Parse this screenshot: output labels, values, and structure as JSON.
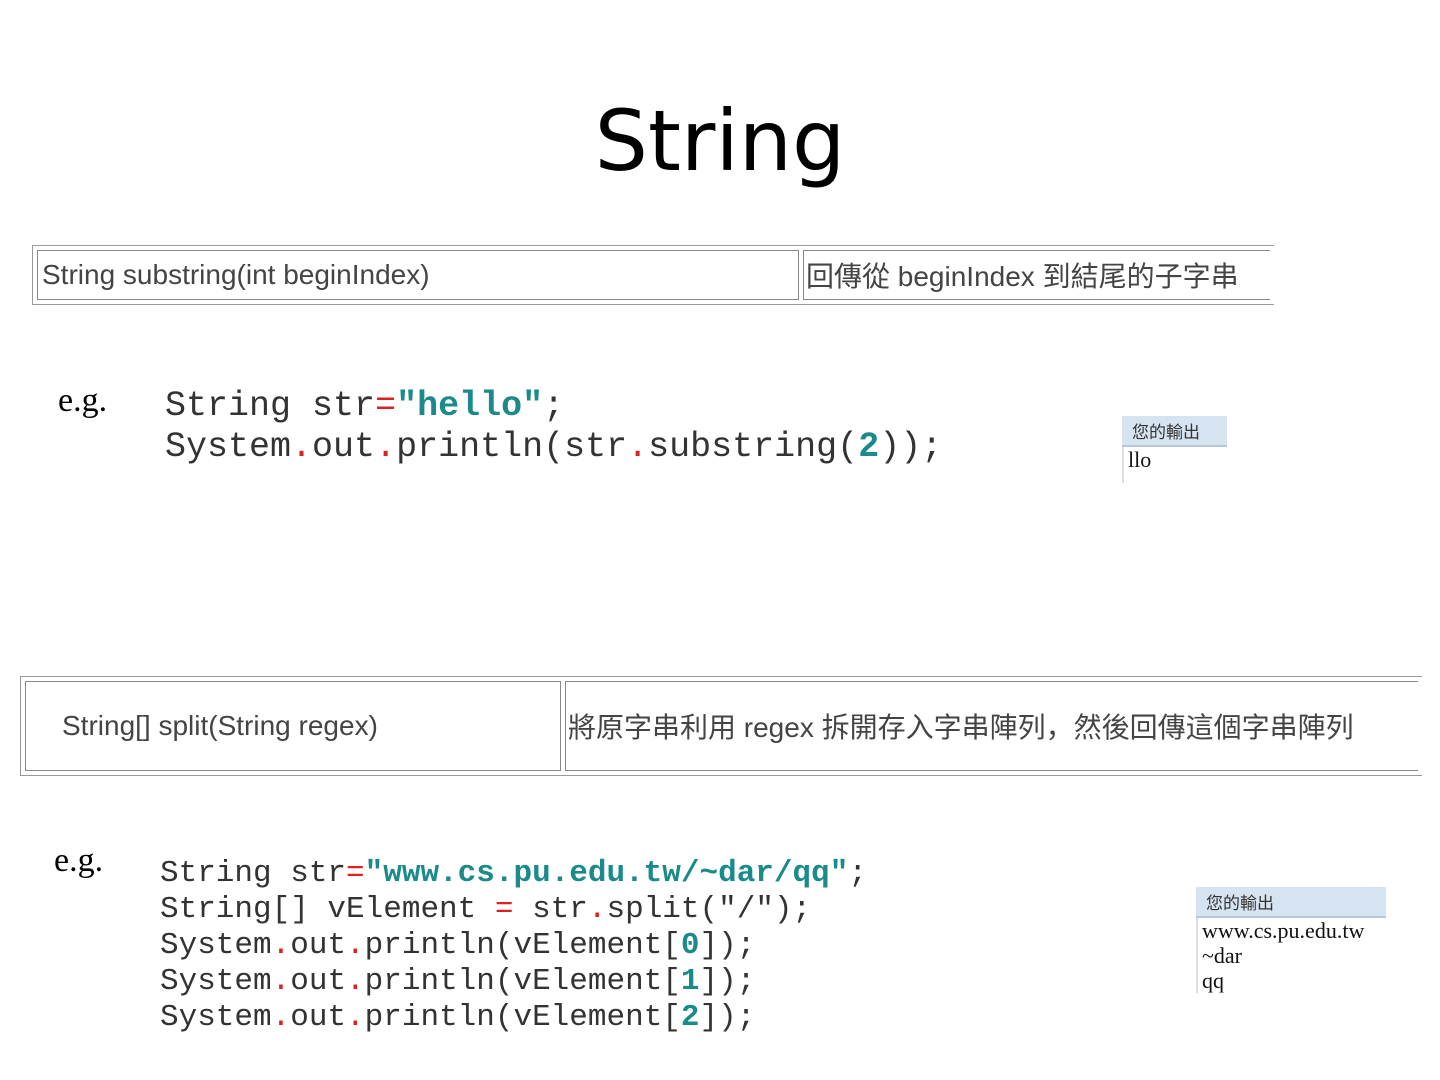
{
  "title": "String",
  "method1": {
    "signature": "String substring(int beginIndex)",
    "description": "回傳從 beginIndex 到結尾的子字串"
  },
  "example1": {
    "label": "e.g.",
    "code": [
      [
        [
          "String str",
          ""
        ],
        [
          "=",
          "op"
        ],
        [
          "\"hello\"",
          "str"
        ],
        [
          ";",
          ""
        ]
      ],
      [
        [
          "System",
          ""
        ],
        [
          ".",
          "op"
        ],
        [
          "out",
          ""
        ],
        [
          ".",
          "op"
        ],
        [
          "println(str",
          ""
        ],
        [
          ".",
          "op"
        ],
        [
          "substring(",
          ""
        ],
        [
          "2",
          "num"
        ],
        [
          "));",
          ""
        ]
      ]
    ],
    "output_header": "您的輸出",
    "output_lines": [
      "llo"
    ]
  },
  "method2": {
    "signature": "String[] split(String regex)",
    "description": "將原字串利用 regex 拆開存入字串陣列，然後回傳這個字串陣列"
  },
  "example2": {
    "label": "e.g.",
    "code": [
      [
        [
          "String str",
          ""
        ],
        [
          "=",
          "op"
        ],
        [
          "\"www.cs.pu.edu.tw/~dar/qq\"",
          "str"
        ],
        [
          ";",
          ""
        ]
      ],
      [
        [
          "String[] vElement ",
          ""
        ],
        [
          "=",
          "op"
        ],
        [
          " str",
          ""
        ],
        [
          ".",
          "op"
        ],
        [
          "split(\"/\");",
          ""
        ]
      ],
      [
        [
          "System",
          ""
        ],
        [
          ".",
          "op"
        ],
        [
          "out",
          ""
        ],
        [
          ".",
          "op"
        ],
        [
          "println(vElement[",
          ""
        ],
        [
          "0",
          "num"
        ],
        [
          "]);",
          ""
        ]
      ],
      [
        [
          "System",
          ""
        ],
        [
          ".",
          "op"
        ],
        [
          "out",
          ""
        ],
        [
          ".",
          "op"
        ],
        [
          "println(vElement[",
          ""
        ],
        [
          "1",
          "num"
        ],
        [
          "]);",
          ""
        ]
      ],
      [
        [
          "System",
          ""
        ],
        [
          ".",
          "op"
        ],
        [
          "out",
          ""
        ],
        [
          ".",
          "op"
        ],
        [
          "println(vElement[",
          ""
        ],
        [
          "2",
          "num"
        ],
        [
          "]);",
          ""
        ]
      ]
    ],
    "output_header": "您的輸出",
    "output_lines": [
      "www.cs.pu.edu.tw",
      "~dar",
      "qq"
    ]
  }
}
